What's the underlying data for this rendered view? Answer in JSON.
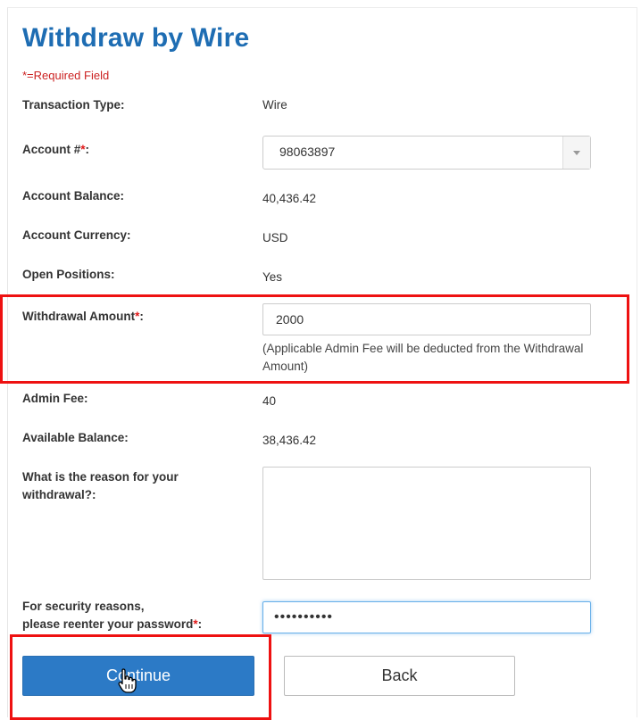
{
  "form": {
    "title": "Withdraw by Wire",
    "required_note": "*=Required Field",
    "required_marker": "*",
    "fields": {
      "transaction_type": {
        "label": "Transaction Type:",
        "value": "Wire"
      },
      "account": {
        "label": "Account #",
        "label_suffix": ":",
        "selected": "98063897"
      },
      "account_balance": {
        "label": "Account Balance:",
        "value": "40,436.42"
      },
      "account_currency": {
        "label": "Account Currency:",
        "value": "USD"
      },
      "open_positions": {
        "label": "Open Positions:",
        "value": "Yes"
      },
      "withdrawal_amount": {
        "label": "Withdrawal Amount",
        "label_suffix": ":",
        "value": "2000",
        "hint": "(Applicable Admin Fee will be deducted from the Withdrawal Amount)"
      },
      "admin_fee": {
        "label": "Admin Fee:",
        "value": "40"
      },
      "available_balance": {
        "label": "Available Balance:",
        "value": "38,436.42"
      },
      "reason": {
        "label_line1": "What is the reason for your",
        "label_line2": "withdrawal?:",
        "value": ""
      },
      "password": {
        "label_line1": "For security reasons,",
        "label_line2": "please reenter your password",
        "label_suffix": ":",
        "masked_value": "••••••••••"
      }
    },
    "buttons": {
      "continue": "Continue",
      "back": "Back"
    }
  },
  "colors": {
    "title": "#1e6db3",
    "required": "#e01818",
    "primary_button": "#2c7ac6",
    "highlight": "#ee1111",
    "focus_border": "#66afe9"
  },
  "icons": {
    "dropdown": "chevron-down-icon",
    "cursor": "hand-pointer-icon"
  }
}
